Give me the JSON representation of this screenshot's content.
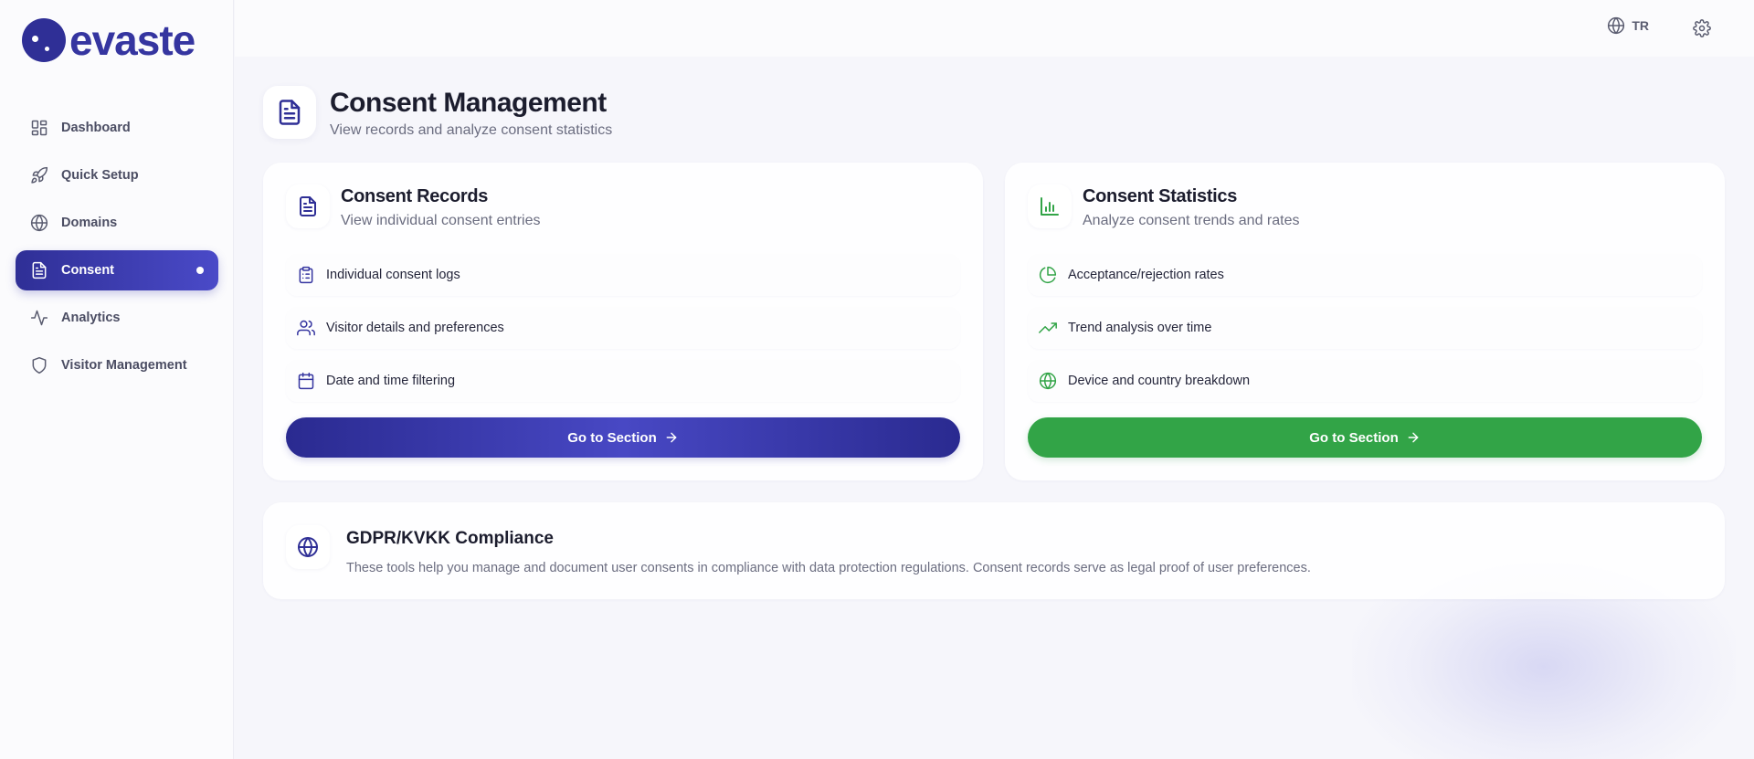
{
  "app": {
    "logo_text": "evaste"
  },
  "sidebar": {
    "items": [
      {
        "label": "Dashboard",
        "icon": "dashboard-icon",
        "active": false
      },
      {
        "label": "Quick Setup",
        "icon": "rocket-icon",
        "active": false
      },
      {
        "label": "Domains",
        "icon": "globe-icon",
        "active": false
      },
      {
        "label": "Consent",
        "icon": "document-icon",
        "active": true
      },
      {
        "label": "Analytics",
        "icon": "activity-icon",
        "active": false
      },
      {
        "label": "Visitor Management",
        "icon": "shield-icon",
        "active": false
      }
    ]
  },
  "topbar": {
    "language": "TR",
    "language_icon": "globe-icon",
    "settings_icon": "gear-icon"
  },
  "page": {
    "title": "Consent Management",
    "subtitle": "View records and analyze consent statistics",
    "icon": "document-icon"
  },
  "cards": [
    {
      "title": "Consent Records",
      "subtitle": "View individual consent entries",
      "icon": "document-icon",
      "features": [
        {
          "label": "Individual consent logs",
          "icon": "clipboard-icon"
        },
        {
          "label": "Visitor details and preferences",
          "icon": "users-icon"
        },
        {
          "label": "Date and time filtering",
          "icon": "calendar-icon"
        }
      ],
      "button_label": "Go to Section",
      "accent": "#3535a0"
    },
    {
      "title": "Consent Statistics",
      "subtitle": "Analyze consent trends and rates",
      "icon": "bar-chart-icon",
      "features": [
        {
          "label": "Acceptance/rejection rates",
          "icon": "pie-chart-icon"
        },
        {
          "label": "Trend analysis over time",
          "icon": "trending-up-icon"
        },
        {
          "label": "Device and country breakdown",
          "icon": "globe-icon"
        }
      ],
      "button_label": "Go to Section",
      "accent": "#32a447"
    }
  ],
  "gdpr": {
    "title": "GDPR/KVKK Compliance",
    "text": "These tools help you manage and document user consents in compliance with data protection regulations. Consent records serve as legal proof of user preferences.",
    "icon": "globe-icon"
  }
}
